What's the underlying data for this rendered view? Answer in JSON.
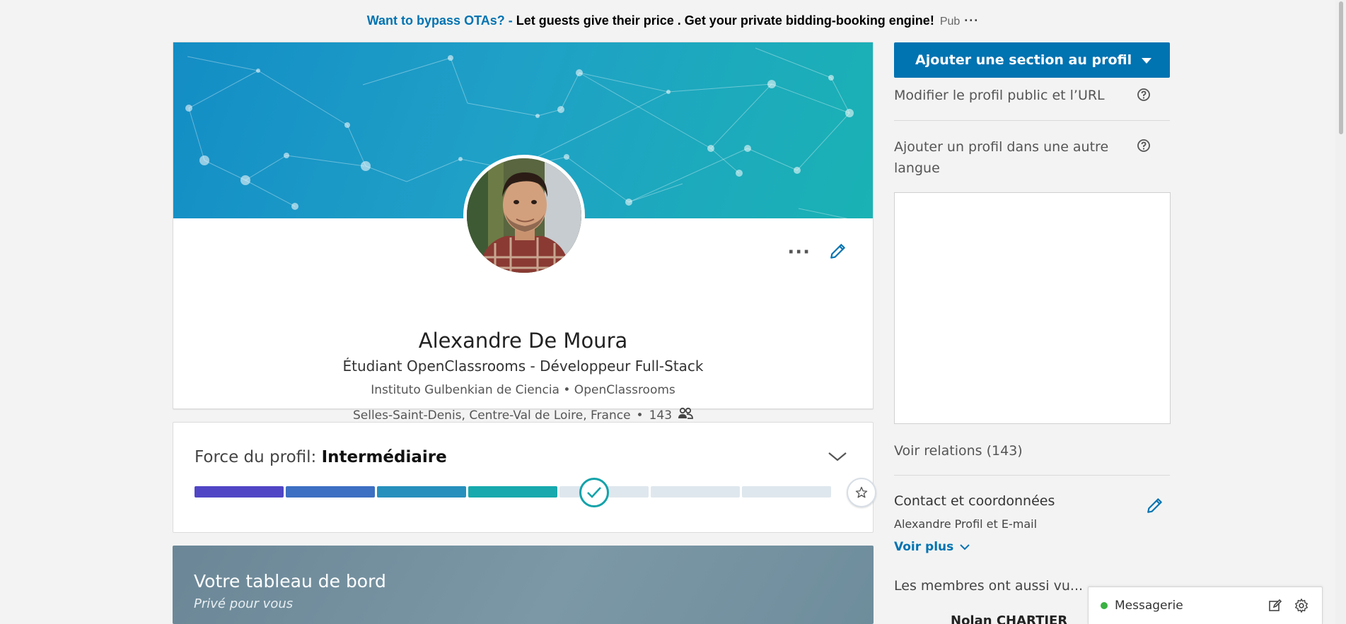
{
  "ad": {
    "link_text": "Want to bypass OTAs? - ",
    "body": "Let guests give their price . Get your private bidding-booking engine!",
    "pub_label": "Pub",
    "more": "···"
  },
  "profile": {
    "name": "Alexandre De Moura",
    "headline": "Étudiant OpenClassrooms - Développeur Full-Stack",
    "institutions": "Instituto Gulbenkian de Ciencia • OpenClassrooms",
    "location": "Selles-Saint-Denis, Centre-Val de Loire, France",
    "separator": "•",
    "connections": "143",
    "more_label": "···"
  },
  "strength": {
    "label": "Force du profil: ",
    "level": "Intermédiaire",
    "filled_segments": 4,
    "total_segments": 7,
    "segment_colors": [
      "#5046c5",
      "#3d6fc2",
      "#2790bd",
      "#17a9ad"
    ],
    "empty_color": "#dfe7ee",
    "accent": "#13a3aa"
  },
  "dashboard": {
    "title": "Votre tableau de bord",
    "subtitle": "Privé pour vous"
  },
  "right_rail": {
    "add_section_label": "Ajouter une section au profil",
    "edit_public_profile": "Modifier le profil public et l’URL",
    "add_language_profile_line1": "Ajouter un profil dans une autre",
    "add_language_profile_line2": "langue",
    "connections_link": "Voir relations (143)",
    "contact_title": "Contact et coordonnées",
    "contact_sub": "Alexandre Profil et E-mail",
    "voir_plus": "Voir plus",
    "members_title": "Les membres ont aussi vu...",
    "peek_name": "Nolan CHARTIER"
  },
  "messaging": {
    "label": "Messagerie",
    "status_color": "#3bb143"
  },
  "colors": {
    "primary": "#0073b1",
    "background": "#f3f3f3"
  }
}
